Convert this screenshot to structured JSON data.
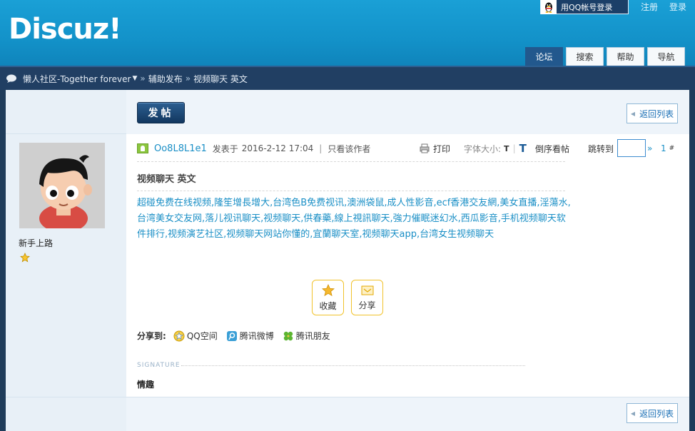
{
  "header": {
    "logo": "Discuz!",
    "qq_login": "用QQ帐号登录",
    "register": "注册",
    "login": "登录",
    "nav": [
      "论坛",
      "搜索",
      "帮助",
      "导航"
    ]
  },
  "breadcrumb": {
    "forum": "懒人社区-Together forever",
    "section": "辅助发布",
    "thread": "视频聊天 英文"
  },
  "toolbar": {
    "post_button": "发帖",
    "back_button": "返回列表"
  },
  "author": {
    "name": "Oo8L8L1e1",
    "group": "新手上路"
  },
  "post": {
    "posted_prefix": "发表于",
    "date": "2016-2-12 17:04",
    "only_author": "只看该作者",
    "print": "打印",
    "font_size_label": "字体大小:",
    "font_size_t": "T",
    "font_size_T": "T",
    "reverse": "倒序看帖",
    "jump_to": "跳转到",
    "jump_arrow": "»",
    "floor": "1",
    "floor_mark": "#",
    "title": "视频聊天 英文",
    "body": "超碰免费在线视频,隆笙增長增大,台湾色B免费视讯,澳洲袋鼠,成人性影音,ecf香港交友網,美女直播,淫蕩水,台湾美女交友网,落儿视讯聊天,视频聊天,供春藥,線上視訊聊天,強力催眠迷幻水,西瓜影音,手机视频聊天软件排行,视频演艺社区,视频聊天网站你懂的,宜蘭聊天室,视频聊天app,台湾女生视频聊天"
  },
  "actions": {
    "favorite": "收藏",
    "share": "分享"
  },
  "share_to": {
    "label": "分享到:",
    "items": [
      "QQ空间",
      "腾讯微博",
      "腾讯朋友"
    ]
  },
  "signature": {
    "label": "SIGNATURE",
    "text": "情趣"
  },
  "colors": {
    "header": "#1392c9",
    "nav_dark": "#213f63",
    "link": "#1a8fc6",
    "button_border": "#f1c22b"
  }
}
